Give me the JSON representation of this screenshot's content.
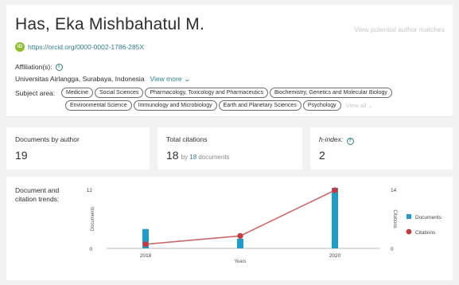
{
  "author": {
    "name": "Has, Eka Mishbahatul M.",
    "view_matches": "View potential author matches",
    "orcid_icon": "iD",
    "orcid_url": "https://orcid.org/0000-0002-1786-285X",
    "affiliation_label": "Affiliation(s):",
    "affiliation": "Universitas Airlangga, Surabaya, Indonesia",
    "view_more": "View more",
    "subject_label": "Subject area:",
    "subjects_row1": [
      "Medicine",
      "Social Sciences",
      "Pharmacology, Toxicology and Pharmaceutics",
      "Biochemistry, Genetics and Molecular Biology"
    ],
    "subjects_row2": [
      "Environmental Science",
      "Immunology and Microbiology",
      "Earth and Planetary Sciences",
      "Psychology"
    ],
    "view_all": "View all"
  },
  "metrics": {
    "documents_label": "Documents by author",
    "documents_value": "19",
    "citations_label": "Total citations",
    "citations_value": "18",
    "citations_by_prefix": "by",
    "citations_by_count": "18",
    "citations_by_suffix": "documents",
    "hindex_label": "h-index:",
    "hindex_value": "2"
  },
  "chart_label": "Document and citation trends:",
  "colors": {
    "documents": "#1e9ccb",
    "citations": "#c8393f",
    "line": "#c96a6a",
    "link": "#2e7d8a"
  },
  "chart_data": {
    "type": "bar",
    "x": [
      2018,
      2019,
      2020
    ],
    "xticks": [
      "2018",
      "2020"
    ],
    "xlabel": "Years",
    "ylabel_left": "Documents",
    "ylabel_right": "Citations",
    "ylim_left": [
      0,
      12
    ],
    "ylim_right": [
      0,
      14
    ],
    "yticks_left": [
      "0",
      "12"
    ],
    "yticks_right": [
      "0",
      "14"
    ],
    "series": [
      {
        "name": "Documents",
        "type": "bar",
        "axis": "left",
        "values": [
          4,
          2,
          13
        ]
      },
      {
        "name": "Citations",
        "type": "line",
        "axis": "right",
        "values": [
          1,
          3,
          14
        ]
      }
    ],
    "legend_position": "right"
  }
}
